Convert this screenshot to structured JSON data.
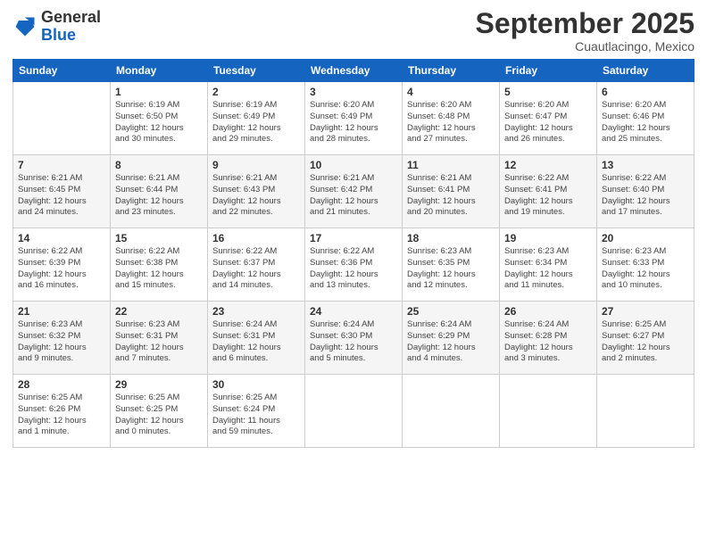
{
  "logo": {
    "general": "General",
    "blue": "Blue"
  },
  "header": {
    "month": "September 2025",
    "location": "Cuautlacingo, Mexico"
  },
  "weekdays": [
    "Sunday",
    "Monday",
    "Tuesday",
    "Wednesday",
    "Thursday",
    "Friday",
    "Saturday"
  ],
  "weeks": [
    [
      {
        "day": "",
        "info": ""
      },
      {
        "day": "1",
        "info": "Sunrise: 6:19 AM\nSunset: 6:50 PM\nDaylight: 12 hours\nand 30 minutes."
      },
      {
        "day": "2",
        "info": "Sunrise: 6:19 AM\nSunset: 6:49 PM\nDaylight: 12 hours\nand 29 minutes."
      },
      {
        "day": "3",
        "info": "Sunrise: 6:20 AM\nSunset: 6:49 PM\nDaylight: 12 hours\nand 28 minutes."
      },
      {
        "day": "4",
        "info": "Sunrise: 6:20 AM\nSunset: 6:48 PM\nDaylight: 12 hours\nand 27 minutes."
      },
      {
        "day": "5",
        "info": "Sunrise: 6:20 AM\nSunset: 6:47 PM\nDaylight: 12 hours\nand 26 minutes."
      },
      {
        "day": "6",
        "info": "Sunrise: 6:20 AM\nSunset: 6:46 PM\nDaylight: 12 hours\nand 25 minutes."
      }
    ],
    [
      {
        "day": "7",
        "info": "Sunrise: 6:21 AM\nSunset: 6:45 PM\nDaylight: 12 hours\nand 24 minutes."
      },
      {
        "day": "8",
        "info": "Sunrise: 6:21 AM\nSunset: 6:44 PM\nDaylight: 12 hours\nand 23 minutes."
      },
      {
        "day": "9",
        "info": "Sunrise: 6:21 AM\nSunset: 6:43 PM\nDaylight: 12 hours\nand 22 minutes."
      },
      {
        "day": "10",
        "info": "Sunrise: 6:21 AM\nSunset: 6:42 PM\nDaylight: 12 hours\nand 21 minutes."
      },
      {
        "day": "11",
        "info": "Sunrise: 6:21 AM\nSunset: 6:41 PM\nDaylight: 12 hours\nand 20 minutes."
      },
      {
        "day": "12",
        "info": "Sunrise: 6:22 AM\nSunset: 6:41 PM\nDaylight: 12 hours\nand 19 minutes."
      },
      {
        "day": "13",
        "info": "Sunrise: 6:22 AM\nSunset: 6:40 PM\nDaylight: 12 hours\nand 17 minutes."
      }
    ],
    [
      {
        "day": "14",
        "info": "Sunrise: 6:22 AM\nSunset: 6:39 PM\nDaylight: 12 hours\nand 16 minutes."
      },
      {
        "day": "15",
        "info": "Sunrise: 6:22 AM\nSunset: 6:38 PM\nDaylight: 12 hours\nand 15 minutes."
      },
      {
        "day": "16",
        "info": "Sunrise: 6:22 AM\nSunset: 6:37 PM\nDaylight: 12 hours\nand 14 minutes."
      },
      {
        "day": "17",
        "info": "Sunrise: 6:22 AM\nSunset: 6:36 PM\nDaylight: 12 hours\nand 13 minutes."
      },
      {
        "day": "18",
        "info": "Sunrise: 6:23 AM\nSunset: 6:35 PM\nDaylight: 12 hours\nand 12 minutes."
      },
      {
        "day": "19",
        "info": "Sunrise: 6:23 AM\nSunset: 6:34 PM\nDaylight: 12 hours\nand 11 minutes."
      },
      {
        "day": "20",
        "info": "Sunrise: 6:23 AM\nSunset: 6:33 PM\nDaylight: 12 hours\nand 10 minutes."
      }
    ],
    [
      {
        "day": "21",
        "info": "Sunrise: 6:23 AM\nSunset: 6:32 PM\nDaylight: 12 hours\nand 9 minutes."
      },
      {
        "day": "22",
        "info": "Sunrise: 6:23 AM\nSunset: 6:31 PM\nDaylight: 12 hours\nand 7 minutes."
      },
      {
        "day": "23",
        "info": "Sunrise: 6:24 AM\nSunset: 6:31 PM\nDaylight: 12 hours\nand 6 minutes."
      },
      {
        "day": "24",
        "info": "Sunrise: 6:24 AM\nSunset: 6:30 PM\nDaylight: 12 hours\nand 5 minutes."
      },
      {
        "day": "25",
        "info": "Sunrise: 6:24 AM\nSunset: 6:29 PM\nDaylight: 12 hours\nand 4 minutes."
      },
      {
        "day": "26",
        "info": "Sunrise: 6:24 AM\nSunset: 6:28 PM\nDaylight: 12 hours\nand 3 minutes."
      },
      {
        "day": "27",
        "info": "Sunrise: 6:25 AM\nSunset: 6:27 PM\nDaylight: 12 hours\nand 2 minutes."
      }
    ],
    [
      {
        "day": "28",
        "info": "Sunrise: 6:25 AM\nSunset: 6:26 PM\nDaylight: 12 hours\nand 1 minute."
      },
      {
        "day": "29",
        "info": "Sunrise: 6:25 AM\nSunset: 6:25 PM\nDaylight: 12 hours\nand 0 minutes."
      },
      {
        "day": "30",
        "info": "Sunrise: 6:25 AM\nSunset: 6:24 PM\nDaylight: 11 hours\nand 59 minutes."
      },
      {
        "day": "",
        "info": ""
      },
      {
        "day": "",
        "info": ""
      },
      {
        "day": "",
        "info": ""
      },
      {
        "day": "",
        "info": ""
      }
    ]
  ]
}
